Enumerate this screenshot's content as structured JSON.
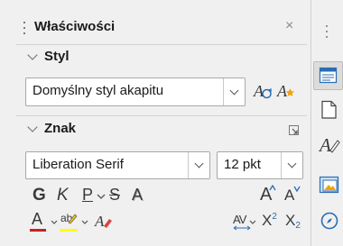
{
  "panel": {
    "title": "Właściwości",
    "close_glyph": "×"
  },
  "style_section": {
    "heading": "Styl",
    "paragraph_style_value": "Domyślny styl akapitu"
  },
  "character_section": {
    "heading": "Znak",
    "font_name_value": "Liberation Serif",
    "font_size_value": "12 pkt",
    "bold_label": "G",
    "italic_label": "K",
    "underline_label": "P",
    "strikethrough_label": "S",
    "shadow_label": "A",
    "grow_label": "A",
    "shrink_label": "A",
    "font_color_label": "A",
    "highlight_label": "ab",
    "superscript_label": "X",
    "superscript_mark": "2",
    "subscript_label": "X",
    "subscript_mark": "2",
    "spacing_label": "AV"
  },
  "colors": {
    "font_color_underline": "#c9211e",
    "highlight_underline": "#ffff00",
    "accent_blue": "#2a6cb5",
    "clear_format_red": "#d9463f"
  },
  "sidebar_tabs": [
    {
      "icon": "properties-icon",
      "active": true
    },
    {
      "icon": "page-icon",
      "active": false
    },
    {
      "icon": "styles-icon",
      "active": false
    },
    {
      "icon": "gallery-icon",
      "active": false
    },
    {
      "icon": "navigator-icon",
      "active": false
    }
  ]
}
